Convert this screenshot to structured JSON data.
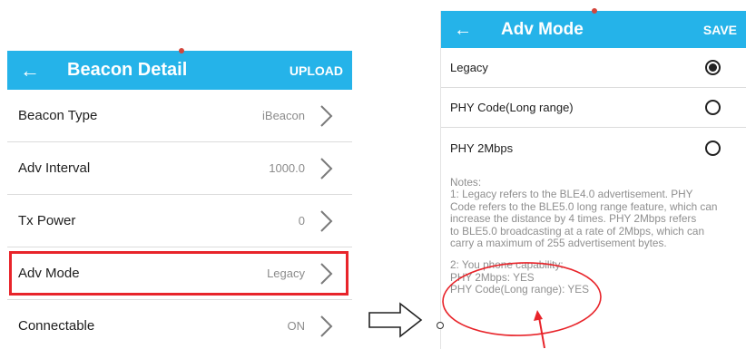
{
  "beacon_detail": {
    "title": "Beacon Detail",
    "upload_label": "UPLOAD",
    "back_icon": "arrow-left-icon",
    "rows": [
      {
        "label": "Beacon Type",
        "value": "iBeacon"
      },
      {
        "label": "Adv Interval",
        "value": "1000.0"
      },
      {
        "label": "Tx Power",
        "value": "0"
      },
      {
        "label": "Adv Mode",
        "value": "Legacy",
        "highlighted": true
      },
      {
        "label": "Connectable",
        "value": "ON"
      }
    ]
  },
  "adv_mode": {
    "title": "Adv Mode",
    "save_label": "SAVE",
    "back_icon": "arrow-left-icon",
    "options": [
      {
        "label": "Legacy",
        "selected": true
      },
      {
        "label": "PHY Code(Long range)",
        "selected": false
      },
      {
        "label": "PHY 2Mbps",
        "selected": false
      }
    ],
    "notes": {
      "heading": "Notes:",
      "lines": [
        "1: Legacy refers to the BLE4.0 advertisement. PHY",
        "Code refers to the BLE5.0 long range feature, which can",
        "increase the distance by 4 times. PHY 2Mbps refers",
        "to BLE5.0 broadcasting at a rate of 2Mbps, which can",
        "carry a maximum of 255 advertisement bytes."
      ],
      "capability": [
        "2: You phone capability:",
        "PHY 2Mbps: YES",
        "PHY Code(Long range): YES"
      ]
    }
  },
  "colors": {
    "appbar": "#25b3e9",
    "highlight": "#e8242a",
    "annotation": "#e8242a"
  }
}
